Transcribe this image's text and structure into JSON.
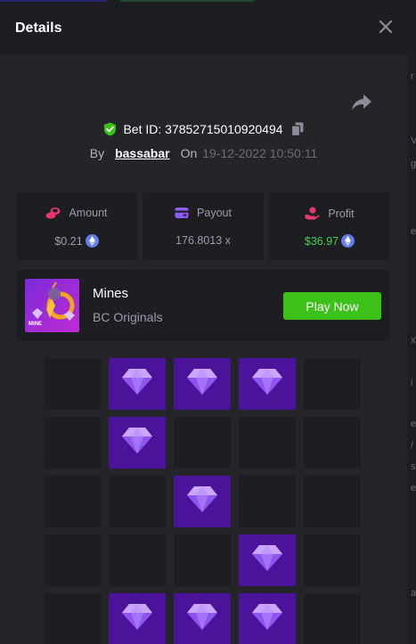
{
  "header": {
    "title": "Details"
  },
  "bet": {
    "id_text": "Bet ID: 37852715010920494",
    "by_label": "By",
    "username": "bassabar",
    "on_label": "On",
    "datetime": "19-12-2022 10:50:11"
  },
  "stats": [
    {
      "label": "Amount",
      "value": "$0.21",
      "icon": "coins-icon",
      "coin": "eth-icon"
    },
    {
      "label": "Payout",
      "value": "176.8013 x",
      "icon": "wallet-icon"
    },
    {
      "label": "Profit",
      "value": "$36.97",
      "icon": "hand-coin-icon",
      "coin": "eth-icon"
    }
  ],
  "game": {
    "name": "Mines",
    "provider": "BC Originals",
    "play_label": "Play Now",
    "thumb_label": "MINE"
  },
  "board": {
    "columns": 5,
    "rows": [
      [
        "empty",
        "gem",
        "gem",
        "gem",
        "empty"
      ],
      [
        "empty",
        "gem",
        "empty",
        "empty",
        "empty"
      ],
      [
        "empty",
        "empty",
        "gem",
        "empty",
        "empty"
      ],
      [
        "empty",
        "empty",
        "empty",
        "gem",
        "empty"
      ],
      [
        "empty",
        "gem",
        "gem",
        "gem",
        "empty"
      ]
    ]
  },
  "right_strip_text": [
    "r",
    "V",
    "g",
    "e",
    "x",
    "i",
    "e",
    "/",
    "s",
    "e",
    "a"
  ],
  "colors": {
    "accent_green": "#3bc117",
    "profit_green": "#3fd24a",
    "gem_tile": "#4a1399",
    "empty_tile": "#1c1e22"
  }
}
